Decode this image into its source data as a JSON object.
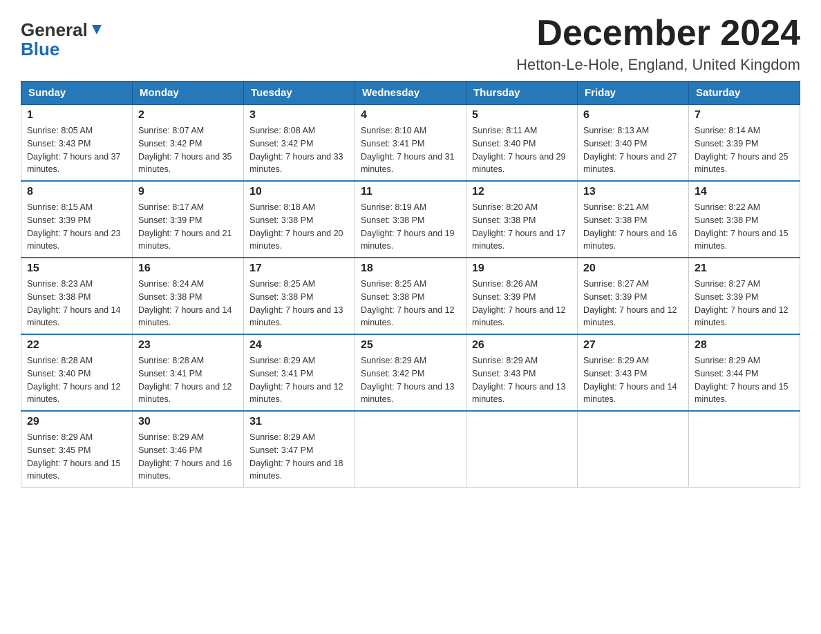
{
  "header": {
    "logo_main": "General",
    "logo_sub": "Blue",
    "month": "December 2024",
    "location": "Hetton-Le-Hole, England, United Kingdom"
  },
  "weekdays": [
    "Sunday",
    "Monday",
    "Tuesday",
    "Wednesday",
    "Thursday",
    "Friday",
    "Saturday"
  ],
  "weeks": [
    [
      {
        "day": "1",
        "sunrise": "Sunrise: 8:05 AM",
        "sunset": "Sunset: 3:43 PM",
        "daylight": "Daylight: 7 hours and 37 minutes."
      },
      {
        "day": "2",
        "sunrise": "Sunrise: 8:07 AM",
        "sunset": "Sunset: 3:42 PM",
        "daylight": "Daylight: 7 hours and 35 minutes."
      },
      {
        "day": "3",
        "sunrise": "Sunrise: 8:08 AM",
        "sunset": "Sunset: 3:42 PM",
        "daylight": "Daylight: 7 hours and 33 minutes."
      },
      {
        "day": "4",
        "sunrise": "Sunrise: 8:10 AM",
        "sunset": "Sunset: 3:41 PM",
        "daylight": "Daylight: 7 hours and 31 minutes."
      },
      {
        "day": "5",
        "sunrise": "Sunrise: 8:11 AM",
        "sunset": "Sunset: 3:40 PM",
        "daylight": "Daylight: 7 hours and 29 minutes."
      },
      {
        "day": "6",
        "sunrise": "Sunrise: 8:13 AM",
        "sunset": "Sunset: 3:40 PM",
        "daylight": "Daylight: 7 hours and 27 minutes."
      },
      {
        "day": "7",
        "sunrise": "Sunrise: 8:14 AM",
        "sunset": "Sunset: 3:39 PM",
        "daylight": "Daylight: 7 hours and 25 minutes."
      }
    ],
    [
      {
        "day": "8",
        "sunrise": "Sunrise: 8:15 AM",
        "sunset": "Sunset: 3:39 PM",
        "daylight": "Daylight: 7 hours and 23 minutes."
      },
      {
        "day": "9",
        "sunrise": "Sunrise: 8:17 AM",
        "sunset": "Sunset: 3:39 PM",
        "daylight": "Daylight: 7 hours and 21 minutes."
      },
      {
        "day": "10",
        "sunrise": "Sunrise: 8:18 AM",
        "sunset": "Sunset: 3:38 PM",
        "daylight": "Daylight: 7 hours and 20 minutes."
      },
      {
        "day": "11",
        "sunrise": "Sunrise: 8:19 AM",
        "sunset": "Sunset: 3:38 PM",
        "daylight": "Daylight: 7 hours and 19 minutes."
      },
      {
        "day": "12",
        "sunrise": "Sunrise: 8:20 AM",
        "sunset": "Sunset: 3:38 PM",
        "daylight": "Daylight: 7 hours and 17 minutes."
      },
      {
        "day": "13",
        "sunrise": "Sunrise: 8:21 AM",
        "sunset": "Sunset: 3:38 PM",
        "daylight": "Daylight: 7 hours and 16 minutes."
      },
      {
        "day": "14",
        "sunrise": "Sunrise: 8:22 AM",
        "sunset": "Sunset: 3:38 PM",
        "daylight": "Daylight: 7 hours and 15 minutes."
      }
    ],
    [
      {
        "day": "15",
        "sunrise": "Sunrise: 8:23 AM",
        "sunset": "Sunset: 3:38 PM",
        "daylight": "Daylight: 7 hours and 14 minutes."
      },
      {
        "day": "16",
        "sunrise": "Sunrise: 8:24 AM",
        "sunset": "Sunset: 3:38 PM",
        "daylight": "Daylight: 7 hours and 14 minutes."
      },
      {
        "day": "17",
        "sunrise": "Sunrise: 8:25 AM",
        "sunset": "Sunset: 3:38 PM",
        "daylight": "Daylight: 7 hours and 13 minutes."
      },
      {
        "day": "18",
        "sunrise": "Sunrise: 8:25 AM",
        "sunset": "Sunset: 3:38 PM",
        "daylight": "Daylight: 7 hours and 12 minutes."
      },
      {
        "day": "19",
        "sunrise": "Sunrise: 8:26 AM",
        "sunset": "Sunset: 3:39 PM",
        "daylight": "Daylight: 7 hours and 12 minutes."
      },
      {
        "day": "20",
        "sunrise": "Sunrise: 8:27 AM",
        "sunset": "Sunset: 3:39 PM",
        "daylight": "Daylight: 7 hours and 12 minutes."
      },
      {
        "day": "21",
        "sunrise": "Sunrise: 8:27 AM",
        "sunset": "Sunset: 3:39 PM",
        "daylight": "Daylight: 7 hours and 12 minutes."
      }
    ],
    [
      {
        "day": "22",
        "sunrise": "Sunrise: 8:28 AM",
        "sunset": "Sunset: 3:40 PM",
        "daylight": "Daylight: 7 hours and 12 minutes."
      },
      {
        "day": "23",
        "sunrise": "Sunrise: 8:28 AM",
        "sunset": "Sunset: 3:41 PM",
        "daylight": "Daylight: 7 hours and 12 minutes."
      },
      {
        "day": "24",
        "sunrise": "Sunrise: 8:29 AM",
        "sunset": "Sunset: 3:41 PM",
        "daylight": "Daylight: 7 hours and 12 minutes."
      },
      {
        "day": "25",
        "sunrise": "Sunrise: 8:29 AM",
        "sunset": "Sunset: 3:42 PM",
        "daylight": "Daylight: 7 hours and 13 minutes."
      },
      {
        "day": "26",
        "sunrise": "Sunrise: 8:29 AM",
        "sunset": "Sunset: 3:43 PM",
        "daylight": "Daylight: 7 hours and 13 minutes."
      },
      {
        "day": "27",
        "sunrise": "Sunrise: 8:29 AM",
        "sunset": "Sunset: 3:43 PM",
        "daylight": "Daylight: 7 hours and 14 minutes."
      },
      {
        "day": "28",
        "sunrise": "Sunrise: 8:29 AM",
        "sunset": "Sunset: 3:44 PM",
        "daylight": "Daylight: 7 hours and 15 minutes."
      }
    ],
    [
      {
        "day": "29",
        "sunrise": "Sunrise: 8:29 AM",
        "sunset": "Sunset: 3:45 PM",
        "daylight": "Daylight: 7 hours and 15 minutes."
      },
      {
        "day": "30",
        "sunrise": "Sunrise: 8:29 AM",
        "sunset": "Sunset: 3:46 PM",
        "daylight": "Daylight: 7 hours and 16 minutes."
      },
      {
        "day": "31",
        "sunrise": "Sunrise: 8:29 AM",
        "sunset": "Sunset: 3:47 PM",
        "daylight": "Daylight: 7 hours and 18 minutes."
      },
      null,
      null,
      null,
      null
    ]
  ]
}
